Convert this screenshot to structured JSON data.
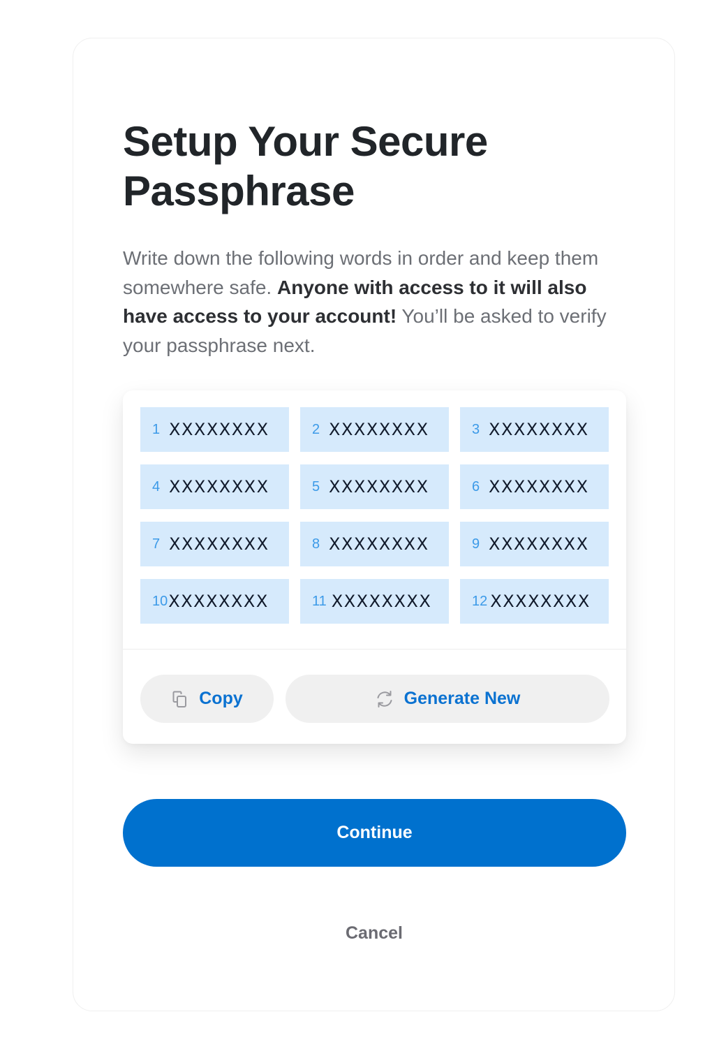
{
  "dialog": {
    "title": "Setup Your Secure Passphrase",
    "description": {
      "part1": "Write down the following words in order and keep them somewhere safe. ",
      "bold": "Anyone with access to it will also have access to your account!",
      "part2": " You’ll be asked to verify your passphrase next."
    }
  },
  "passphrase": {
    "words": [
      {
        "index": "1",
        "word": "XXXXXXXX"
      },
      {
        "index": "2",
        "word": "XXXXXXXX"
      },
      {
        "index": "3",
        "word": "XXXXXXXX"
      },
      {
        "index": "4",
        "word": "XXXXXXXX"
      },
      {
        "index": "5",
        "word": "XXXXXXXX"
      },
      {
        "index": "6",
        "word": "XXXXXXXX"
      },
      {
        "index": "7",
        "word": "XXXXXXXX"
      },
      {
        "index": "8",
        "word": "XXXXXXXX"
      },
      {
        "index": "9",
        "word": "XXXXXXXX"
      },
      {
        "index": "10",
        "word": "XXXXXXXX"
      },
      {
        "index": "11",
        "word": "XXXXXXXX"
      },
      {
        "index": "12",
        "word": "XXXXXXXX"
      }
    ],
    "copy_label": "Copy",
    "copy_icon": "copy-icon",
    "generate_label": "Generate New",
    "generate_icon": "refresh-icon"
  },
  "actions": {
    "continue_label": "Continue",
    "cancel_label": "Cancel"
  },
  "colors": {
    "primary": "#0071ce",
    "link": "#0b72d1",
    "word_bg": "#d6eafc",
    "word_index": "#3c9ae8"
  }
}
